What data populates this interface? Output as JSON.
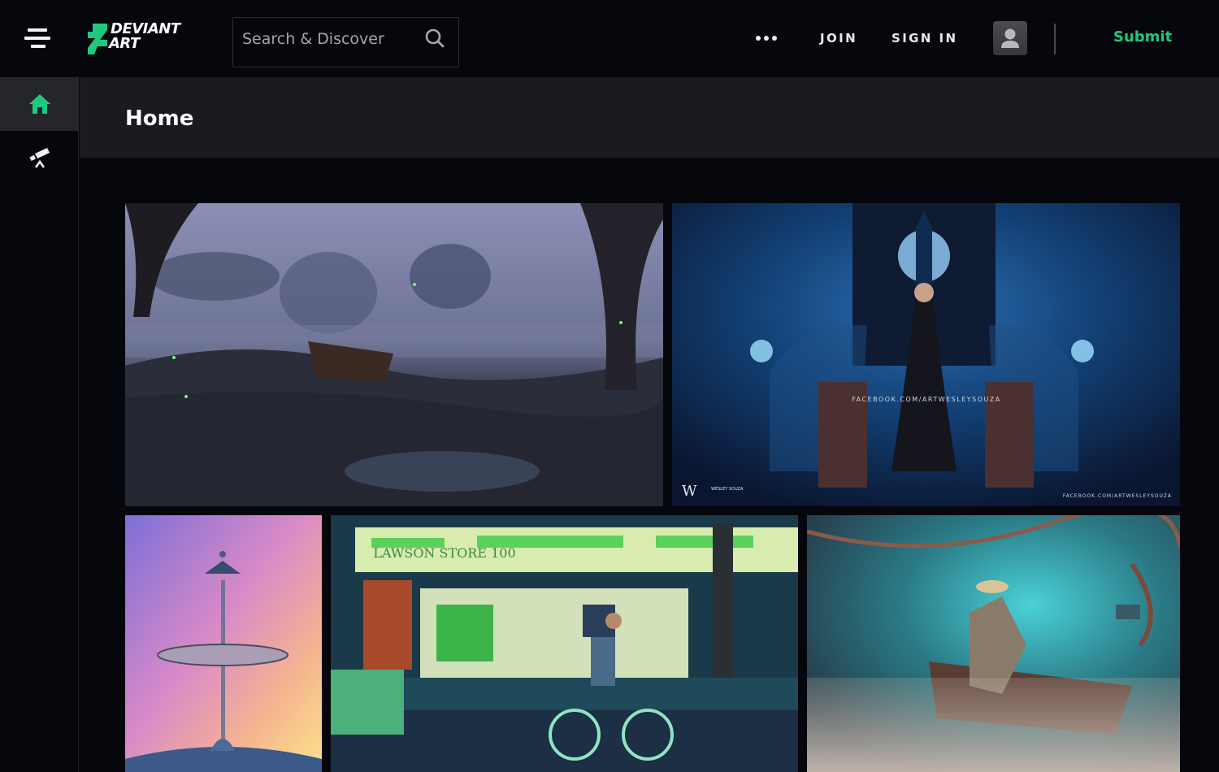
{
  "header": {
    "logo_line1": "DEVIANT",
    "logo_line2": "ART",
    "search_placeholder": "Search & Discover",
    "more_label": "More",
    "join_label": "JOIN",
    "signin_label": "SIGN IN",
    "submit_label": "Submit"
  },
  "sidebar": {
    "items": [
      {
        "label": "Home",
        "icon": "home-icon",
        "active": true
      },
      {
        "label": "Discover",
        "icon": "telescope-icon",
        "active": false
      }
    ]
  },
  "page": {
    "title": "Home"
  },
  "gallery": {
    "items": [
      {
        "description": "Misty swamp at dusk with a rowboat on the shore and fireflies"
      },
      {
        "description": "Dark fantasy woman floating between skeletons and candles, blue smoke",
        "watermark": "FACEBOOK.COM/ARTWESLEYSOUZA",
        "signature": "WESLEY SOUZA"
      },
      {
        "description": "Water droplet sculpture against purple-to-yellow gradient"
      },
      {
        "description": "Night street with cyclist in front of convenience store",
        "sign_text": "LAWSON STORE 100"
      },
      {
        "description": "Old man with hat in a wooden boat in a misty teal swamp"
      }
    ]
  },
  "colors": {
    "accent": "#1ec97f",
    "background": "#06070d",
    "title_band": "#191b20"
  }
}
